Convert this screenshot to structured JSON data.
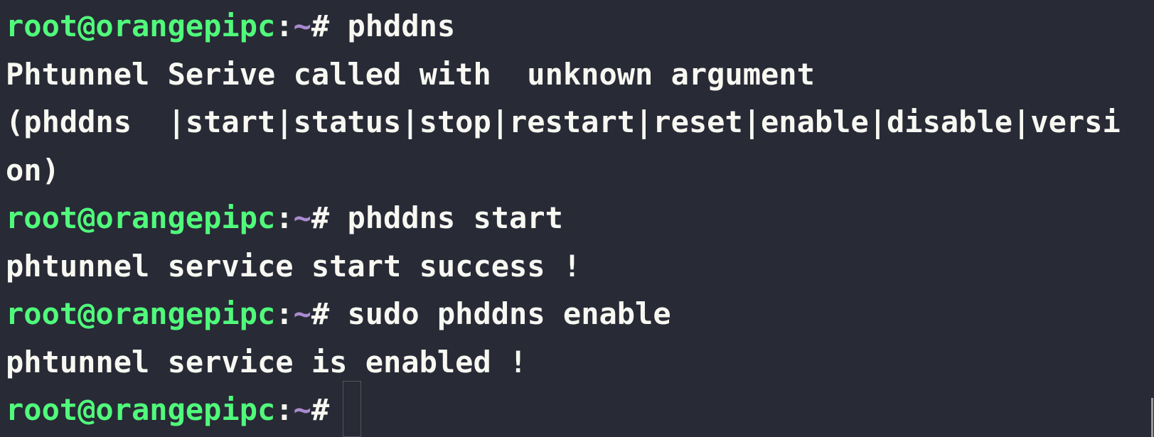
{
  "prompt": {
    "user_host": "root@orangepipc",
    "colon": ":",
    "path": "~",
    "symbol": "# "
  },
  "lines": [
    {
      "type": "prompt",
      "command": "phddns"
    },
    {
      "type": "output",
      "text": "Phtunnel Serive called with  unknown argument"
    },
    {
      "type": "output",
      "text": "(phddns  |start|status|stop|restart|reset|enable|disable|versi"
    },
    {
      "type": "output",
      "text": "on)"
    },
    {
      "type": "prompt",
      "command": "phddns start"
    },
    {
      "type": "output",
      "text": "phtunnel service start success !"
    },
    {
      "type": "prompt",
      "command": "sudo phddns enable"
    },
    {
      "type": "output",
      "text": "phtunnel service is enabled !"
    },
    {
      "type": "prompt",
      "command": ""
    }
  ],
  "colors": {
    "background": "#282a36",
    "user_host": "#50fa7b",
    "path": "#a98bd0",
    "text": "#f8f8f2"
  }
}
